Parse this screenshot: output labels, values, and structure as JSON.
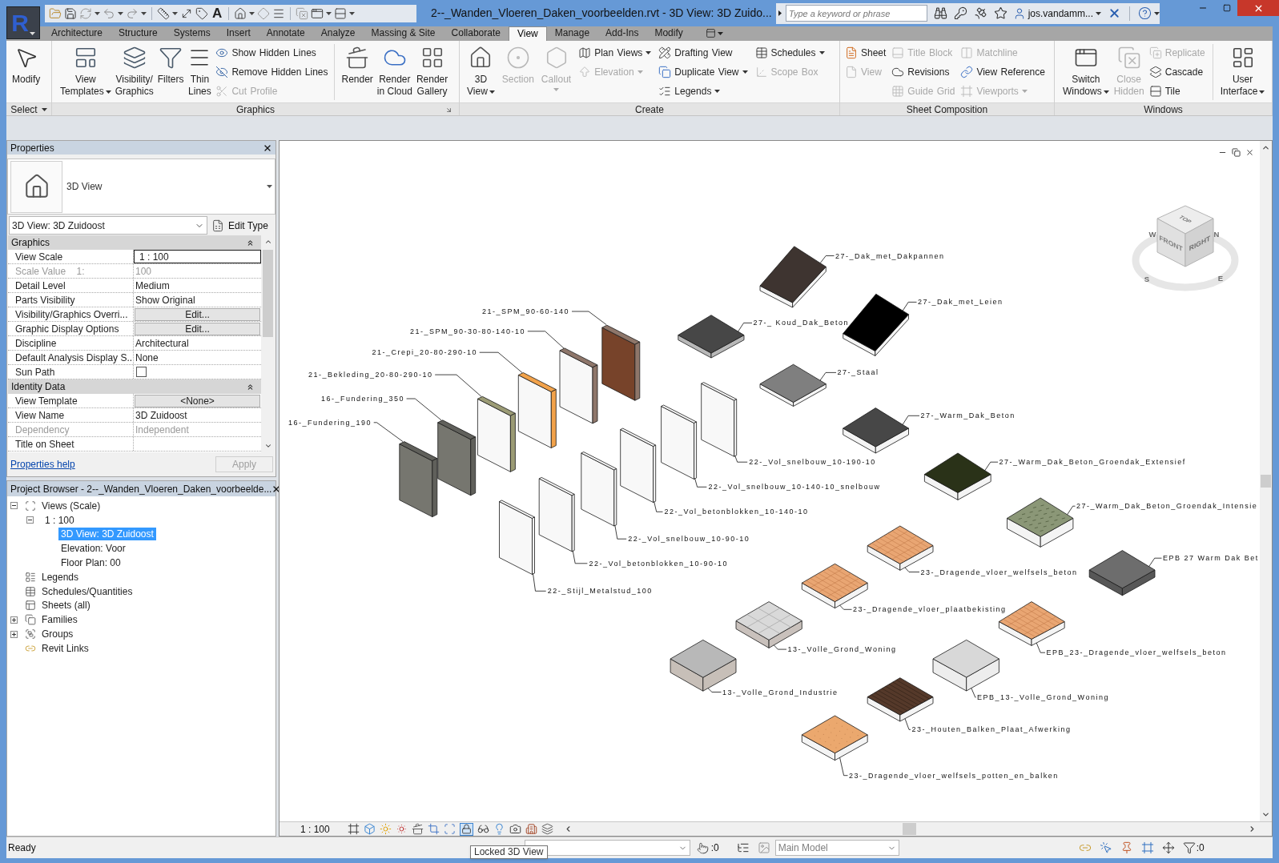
{
  "app": {
    "logo": "R",
    "title": "2--_Wanden_Vloeren_Daken_voorbeelden.rvt - 3D View: 3D Zuido...",
    "text_tool": "A",
    "search": {
      "placeholder": "Type a keyword or phrase"
    },
    "user": "jos.vandamm..."
  },
  "tabs": [
    {
      "label": "Architecture",
      "selected": false
    },
    {
      "label": "Structure",
      "selected": false
    },
    {
      "label": "Systems",
      "selected": false
    },
    {
      "label": "Insert",
      "selected": false
    },
    {
      "label": "Annotate",
      "selected": false
    },
    {
      "label": "Analyze",
      "selected": false
    },
    {
      "label": "Massing & Site",
      "selected": false
    },
    {
      "label": "Collaborate",
      "selected": false
    },
    {
      "label": "View",
      "selected": true
    },
    {
      "label": "Manage",
      "selected": false
    },
    {
      "label": "Add-Ins",
      "selected": false
    },
    {
      "label": "Modify",
      "selected": false
    }
  ],
  "ribbon": {
    "panels": [
      {
        "title": "Select",
        "menu": true,
        "items": [
          {
            "kind": "large",
            "lines": [
              "Modify"
            ],
            "disabled": false
          }
        ]
      },
      {
        "title": "Graphics",
        "launcher": true,
        "items": [
          {
            "kind": "large",
            "lines": [
              "View",
              "Templates"
            ],
            "dropdown": true,
            "disabled": false
          },
          {
            "kind": "large",
            "lines": [
              "Visibility/",
              "Graphics"
            ],
            "disabled": false
          },
          {
            "kind": "large",
            "lines": [
              "Filters"
            ],
            "disabled": false
          },
          {
            "kind": "large",
            "lines": [
              "Thin",
              "Lines"
            ],
            "disabled": false
          },
          {
            "kind": "stack",
            "items": [
              {
                "label": "Show Hidden Lines",
                "disabled": false
              },
              {
                "label": "Remove Hidden Lines",
                "disabled": false
              },
              {
                "label": "Cut Profile",
                "disabled": true
              }
            ]
          },
          {
            "kind": "separator"
          },
          {
            "kind": "large",
            "lines": [
              "Render"
            ],
            "disabled": false
          },
          {
            "kind": "large",
            "lines": [
              "Render",
              "in Cloud"
            ],
            "disabled": false
          },
          {
            "kind": "large",
            "lines": [
              "Render",
              "Gallery"
            ],
            "disabled": false
          }
        ]
      },
      {
        "title": "Create",
        "items": [
          {
            "kind": "large",
            "lines": [
              "3D",
              "View"
            ],
            "dropdown": true,
            "disabled": false
          },
          {
            "kind": "large",
            "lines": [
              "Section"
            ],
            "disabled": true
          },
          {
            "kind": "large",
            "lines": [
              "Callout"
            ],
            "dropdown": true,
            "disabled": true
          },
          {
            "kind": "stack",
            "items": [
              {
                "label": "Plan Views",
                "dropdown": true,
                "disabled": false
              },
              {
                "label": "Elevation",
                "dropdown": true,
                "disabled": true
              }
            ]
          },
          {
            "kind": "stack",
            "items": [
              {
                "label": "Drafting View",
                "disabled": false
              },
              {
                "label": "Duplicate View",
                "dropdown": true,
                "disabled": false
              },
              {
                "label": "Legends",
                "dropdown": true,
                "disabled": false
              }
            ]
          },
          {
            "kind": "stack",
            "items": [
              {
                "label": "Schedules",
                "dropdown": true,
                "disabled": false
              },
              {
                "label": "Scope Box",
                "disabled": true
              }
            ]
          }
        ]
      },
      {
        "title": "Sheet Composition",
        "items": [
          {
            "kind": "stack",
            "items": [
              {
                "label": "Sheet",
                "disabled": false
              },
              {
                "label": "View",
                "disabled": true
              }
            ]
          },
          {
            "kind": "stack",
            "items": [
              {
                "label": "Title Block",
                "disabled": true
              },
              {
                "label": "Revisions",
                "disabled": false
              },
              {
                "label": "Guide Grid",
                "disabled": true
              }
            ]
          },
          {
            "kind": "stack",
            "items": [
              {
                "label": "Matchline",
                "disabled": true
              },
              {
                "label": "View Reference",
                "disabled": false
              },
              {
                "label": "Viewports",
                "dropdown": true,
                "disabled": true
              }
            ]
          }
        ]
      },
      {
        "title": "Windows",
        "items": [
          {
            "kind": "large",
            "lines": [
              "Switch",
              "Windows"
            ],
            "dropdown": true,
            "disabled": false
          },
          {
            "kind": "large",
            "lines": [
              "Close",
              "Hidden"
            ],
            "disabled": true
          },
          {
            "kind": "stack",
            "items": [
              {
                "label": "Replicate",
                "disabled": true
              },
              {
                "label": "Cascade",
                "disabled": false
              },
              {
                "label": "Tile",
                "disabled": false
              }
            ]
          },
          {
            "kind": "separator"
          },
          {
            "kind": "large",
            "lines": [
              "User",
              "Interface"
            ],
            "dropdown": true,
            "disabled": false
          }
        ]
      }
    ]
  },
  "properties": {
    "title": "Properties",
    "type_name": "3D View",
    "instance": "3D View: 3D Zuidoost",
    "edit_type": "Edit Type",
    "groups": [
      {
        "name": "Graphics",
        "expanded": true,
        "rows": [
          {
            "label": "View Scale",
            "value": "1 : 100",
            "kind": "input",
            "disabled": false
          },
          {
            "label": "Scale Value    1:",
            "value": "100",
            "kind": "text",
            "disabled": true
          },
          {
            "label": "Detail Level",
            "value": "Medium",
            "kind": "text",
            "disabled": false
          },
          {
            "label": "Parts Visibility",
            "value": "Show Original",
            "kind": "text",
            "disabled": false
          },
          {
            "label": "Visibility/Graphics Overri...",
            "value": "Edit...",
            "kind": "button",
            "disabled": false
          },
          {
            "label": "Graphic Display Options",
            "value": "Edit...",
            "kind": "button",
            "disabled": false
          },
          {
            "label": "Discipline",
            "value": "Architectural",
            "kind": "text",
            "disabled": false
          },
          {
            "label": "Default Analysis Display S...",
            "value": "None",
            "kind": "text",
            "disabled": false
          },
          {
            "label": "Sun Path",
            "kind": "checkbox",
            "checked": false,
            "disabled": false
          }
        ]
      },
      {
        "name": "Identity Data",
        "expanded": true,
        "rows": [
          {
            "label": "View Template",
            "value": "<None>",
            "kind": "button",
            "disabled": false
          },
          {
            "label": "View Name",
            "value": "3D Zuidoost",
            "kind": "text",
            "disabled": false
          },
          {
            "label": "Dependency",
            "value": "Independent",
            "kind": "text",
            "disabled": true
          },
          {
            "label": "Title on Sheet",
            "kind": "text",
            "disabled": false
          }
        ]
      }
    ],
    "help_link": "Properties help",
    "apply": {
      "label": "Apply",
      "disabled": true
    }
  },
  "project_browser": {
    "title": "Project Browser - 2--_Wanden_Vloeren_Daken_voorbeelde...",
    "tree": [
      {
        "label": "Views (Scale)",
        "expanded": true,
        "selected": false,
        "children": [
          {
            "label": "1 : 100",
            "expanded": true,
            "selected": false,
            "children": [
              {
                "label": "3D View: 3D Zuidoost",
                "selected": true
              },
              {
                "label": "Elevation: Voor",
                "selected": false
              },
              {
                "label": "Floor Plan: 00",
                "selected": false
              }
            ]
          }
        ]
      },
      {
        "label": "Legends",
        "selected": false
      },
      {
        "label": "Schedules/Quantities",
        "selected": false
      },
      {
        "label": "Sheets (all)",
        "selected": false
      },
      {
        "label": "Families",
        "expanded": false,
        "selected": false
      },
      {
        "label": "Groups",
        "expanded": false,
        "selected": false
      },
      {
        "label": "Revit Links",
        "selected": false
      }
    ]
  },
  "view_window": {
    "wall_types": [
      {
        "label": "21-_SPM_90-60-140",
        "color": "#77432a"
      },
      {
        "label": "21-_SPM_90-30-80-140-10",
        "color": "#f8f8f8"
      },
      {
        "label": "21-_Crepi_20-80-290-10",
        "color": "#f8f8f8"
      },
      {
        "label": "21-_Bekleding_20-80-290-10",
        "color": "#f8f8f8"
      },
      {
        "label": "16-_Fundering_350",
        "color": "#76766f"
      },
      {
        "label": "16-_Fundering_190",
        "color": "#76766f"
      },
      {
        "label": "22-_Vol_snelbouw_10-190-10",
        "color": "#f8f8f8"
      },
      {
        "label": "22-_Vol_snelbouw_10-140-10_snelbouw",
        "color": "#f8f8f8"
      },
      {
        "label": "22-_Vol_betonblokken_10-140-10",
        "color": "#f8f8f8"
      },
      {
        "label": "22-_Vol_snelbouw_10-90-10",
        "color": "#f8f8f8"
      },
      {
        "label": "22-_Vol_betonblokken_10-90-10",
        "color": "#f8f8f8"
      },
      {
        "label": "22-_Stijl_Metalstud_100",
        "color": "#f8f8f8"
      }
    ],
    "floor_and_roof_types": [
      {
        "label": "27-_Dak_met_Dakpannen",
        "color": "#3e3430",
        "kind": "plain"
      },
      {
        "label": "27-_Dak_met_Leien",
        "color": "#000000",
        "kind": "plain"
      },
      {
        "label": "27-_ Koud_Dak_Beton",
        "color": "#474747",
        "kind": "plain"
      },
      {
        "label": "27-_Staal",
        "color": "#7f7f7f",
        "kind": "plain"
      },
      {
        "label": "27-_Warm_Dak_Beton",
        "color": "#474747",
        "kind": "plain"
      },
      {
        "label": "27-_Warm_Dak_Beton_Groendak_Extensief",
        "color": "#2a3218",
        "kind": "plain"
      },
      {
        "label": "27-_Warm_Dak_Beton_Groendak_Intensie",
        "color": "#8b9777",
        "kind": "grass"
      },
      {
        "label": "EPB 27 Warm Dak Bet",
        "color": "#6d6d6d",
        "kind": "plain"
      },
      {
        "label": "23-_Dragende_vloer_welfsels_beton",
        "color": "#e9a673",
        "kind": "brick"
      },
      {
        "label": "23-_Dragende_vloer_plaatbekisting",
        "color": "#e9a673",
        "kind": "brick"
      },
      {
        "label": "13-_Volle_Grond_Woning",
        "color": "#d9d9d9",
        "kind": "grid"
      },
      {
        "label": "EPB_23-_Dragende_vloer_welfsels_beton",
        "color": "#e9a673",
        "kind": "brick"
      },
      {
        "label": "13-_Volle_Grond_Industrie",
        "color": "#b8b8b8",
        "kind": "plain"
      },
      {
        "label": "EPB_13-_Volle_Grond_Woning",
        "color": "#d8d8d8",
        "kind": "plain"
      },
      {
        "label": "23-_Houten_Balken_Plaat_Afwerking",
        "color": "#55392a",
        "kind": "planks"
      },
      {
        "label": "23-_Dragende_vloer_welfsels_potten_en_balken",
        "color": "#eba86e",
        "kind": "speckle"
      }
    ],
    "view_cube": {
      "faces": [
        "TOP",
        "FRONT",
        "RIGHT"
      ],
      "compass": [
        "W",
        "N",
        "S",
        "E"
      ]
    }
  },
  "view_bar": {
    "scale": "1 : 100",
    "locked_3d": true
  },
  "status_bar": {
    "message": "Ready",
    "tooltip": "Locked 3D View",
    "editable_count": ":0",
    "design_option": "Main Model",
    "filter_count": ":0"
  }
}
